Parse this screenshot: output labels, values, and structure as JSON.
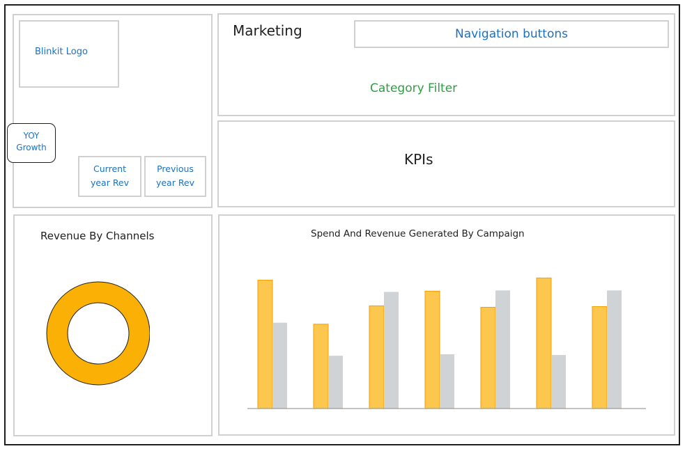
{
  "header": {
    "title": "Marketing",
    "navigation": "Navigation buttons",
    "category_filter": "Category Filter"
  },
  "sidebar": {
    "logo": "Blinkit Logo",
    "yoy": [
      "YOY",
      "Growth"
    ],
    "current_rev": [
      "Current",
      "year Rev"
    ],
    "previous_rev": [
      "Previous",
      "year Rev"
    ]
  },
  "kpis": {
    "label": "KPIs"
  },
  "donut": {
    "title": "Revenue By Channels",
    "color": "#fab005"
  },
  "colors": {
    "spend": "#fcc74f",
    "revenue": "#cfd3d6",
    "spend_stroke": "#f59f00"
  },
  "chart_data": {
    "type": "bar",
    "title": "Spend And Revenue Generated By Campaign",
    "categories": [
      "",
      "",
      "",
      "",
      "",
      "",
      ""
    ],
    "series": [
      {
        "values": [
          175,
          115,
          140,
          160,
          138,
          178,
          139
        ]
      },
      {
        "values": [
          117,
          72,
          159,
          74,
          161,
          73,
          161
        ]
      }
    ],
    "ylim": [
      0,
      185
    ]
  }
}
